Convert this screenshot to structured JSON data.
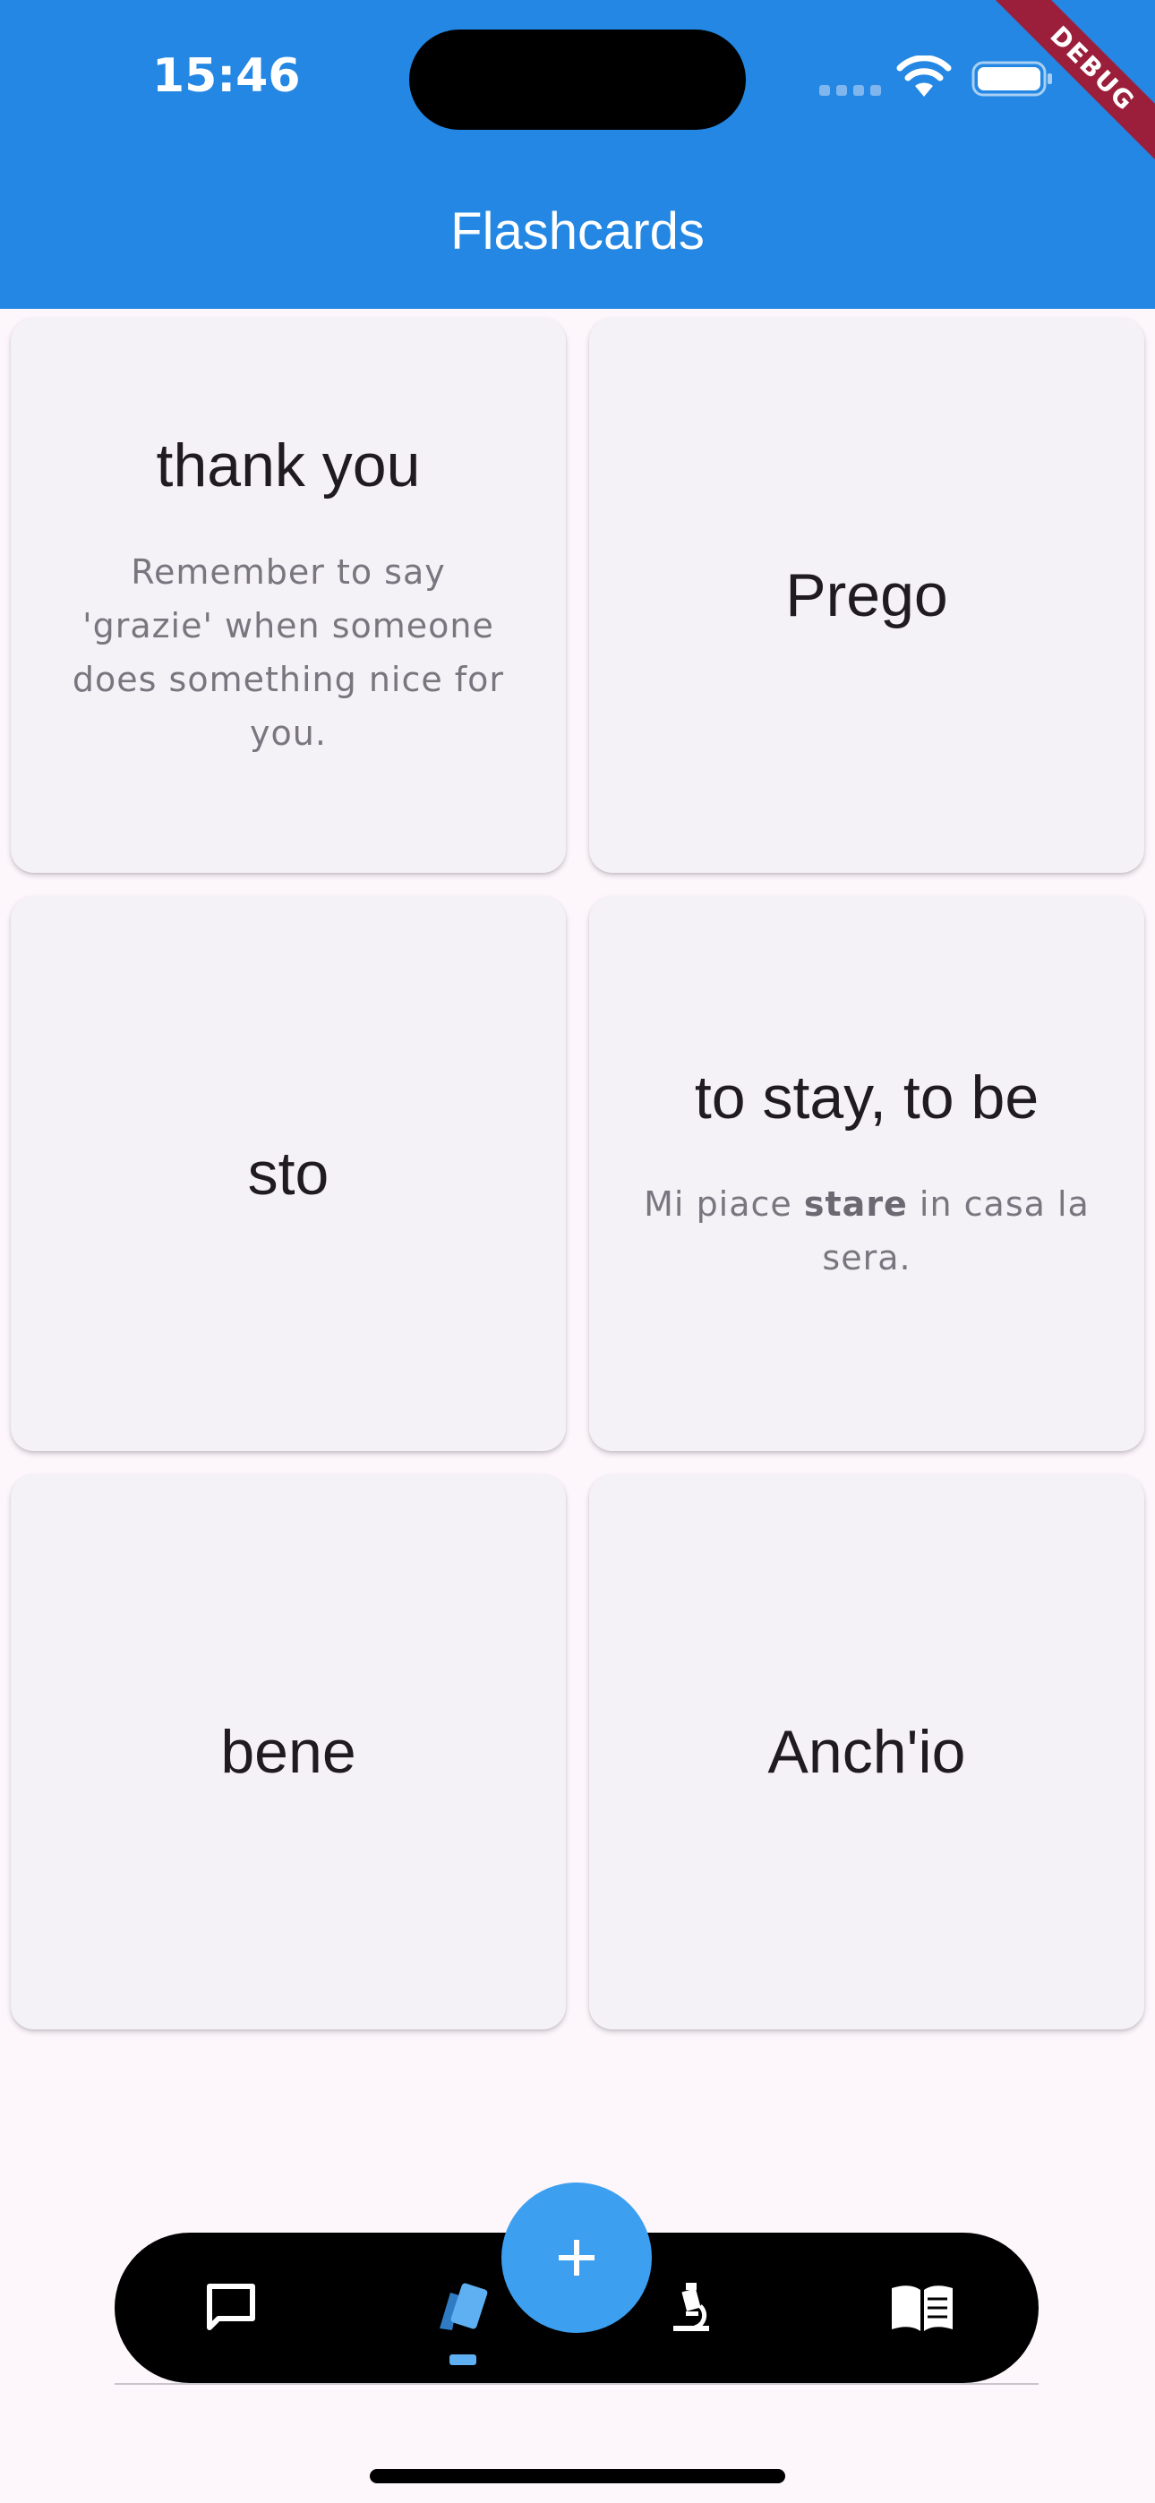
{
  "status_bar": {
    "time": "15:46"
  },
  "debug_banner": "DEBUG",
  "app_bar": {
    "title": "Flashcards"
  },
  "cards": [
    {
      "term": "thank you",
      "note": "Remember to say 'grazie' when someone does something nice for you."
    },
    {
      "term": "Prego"
    },
    {
      "term": "sto"
    },
    {
      "term": "to stay, to be",
      "note_before": "Mi piace ",
      "note_bold": "stare",
      "note_after": " in casa la sera."
    },
    {
      "term": "bene"
    },
    {
      "term": "Anch'io"
    }
  ],
  "bottom_nav": {
    "items": [
      {
        "icon": "chat-bubble-icon"
      },
      {
        "icon": "flashcards-icon",
        "selected": true
      },
      {
        "icon": "microscope-icon"
      },
      {
        "icon": "book-icon"
      }
    ],
    "fab_icon": "plus-icon"
  },
  "colors": {
    "app_bar": "#2387e3",
    "background": "#fdf6fb",
    "card": "#f5f2f7",
    "fab": "#3c9ff0",
    "nav_selected": "#5fb0f2"
  }
}
